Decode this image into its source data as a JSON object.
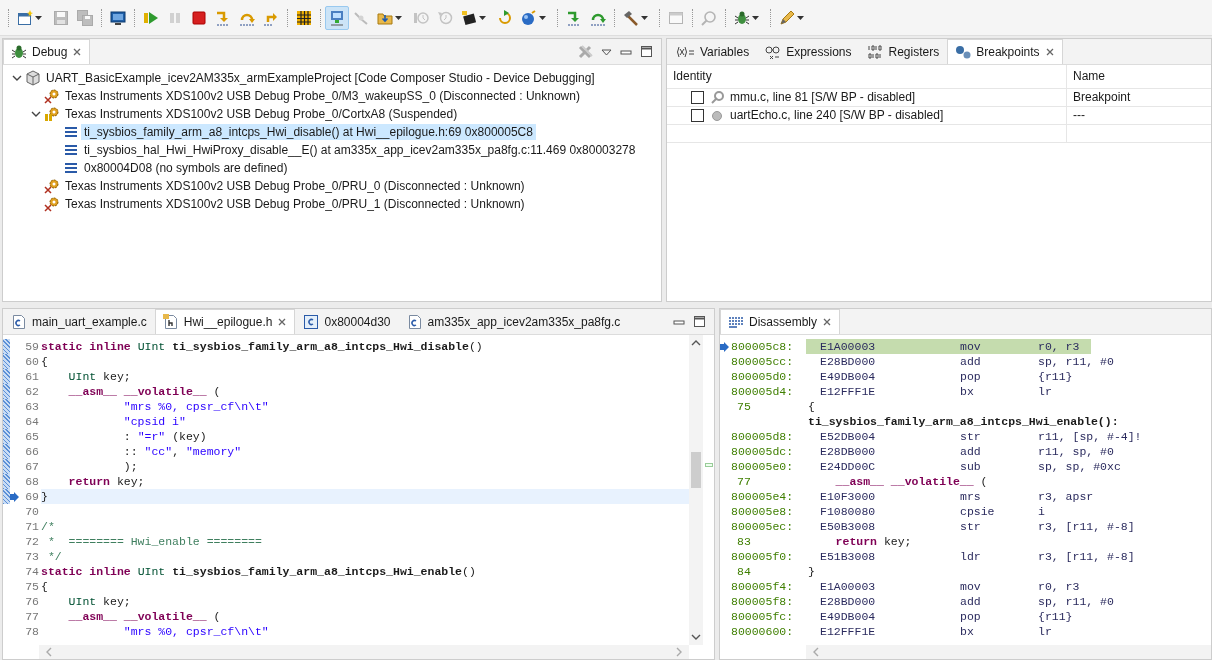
{
  "toolbar": [
    [
      {
        "kind": "new",
        "dropdown": true,
        "disabled": false,
        "selected": false
      },
      {
        "kind": "save",
        "dropdown": false,
        "disabled": true,
        "selected": false
      },
      {
        "kind": "save-all",
        "dropdown": false,
        "disabled": true,
        "selected": false
      }
    ],
    [
      {
        "kind": "monitor",
        "dropdown": false,
        "disabled": false,
        "selected": false
      }
    ],
    [
      {
        "kind": "resume",
        "dropdown": false,
        "disabled": false,
        "selected": false
      },
      {
        "kind": "suspend",
        "dropdown": false,
        "disabled": true,
        "selected": false
      },
      {
        "kind": "terminate",
        "dropdown": false,
        "disabled": false,
        "selected": false
      },
      {
        "kind": "step-into",
        "dropdown": false,
        "disabled": false,
        "selected": false
      },
      {
        "kind": "step-over",
        "dropdown": false,
        "disabled": false,
        "selected": false
      },
      {
        "kind": "step-return",
        "dropdown": false,
        "disabled": false,
        "selected": false
      }
    ],
    [
      {
        "kind": "grid",
        "dropdown": false,
        "disabled": false,
        "selected": false
      }
    ],
    [
      {
        "kind": "connect",
        "dropdown": false,
        "disabled": false,
        "selected": true
      },
      {
        "kind": "cable",
        "dropdown": false,
        "disabled": true,
        "selected": false
      },
      {
        "kind": "load",
        "dropdown": true,
        "disabled": false,
        "selected": false
      },
      {
        "kind": "restart",
        "dropdown": false,
        "disabled": true,
        "selected": false
      },
      {
        "kind": "reset",
        "dropdown": false,
        "disabled": true,
        "selected": false
      },
      {
        "kind": "chip",
        "dropdown": true,
        "disabled": false,
        "selected": false
      },
      {
        "kind": "loop",
        "dropdown": false,
        "disabled": false,
        "selected": false
      },
      {
        "kind": "sphere",
        "dropdown": true,
        "disabled": false,
        "selected": false
      }
    ],
    [
      {
        "kind": "asm-step-into",
        "dropdown": false,
        "disabled": false,
        "selected": false
      },
      {
        "kind": "asm-step-over",
        "dropdown": false,
        "disabled": false,
        "selected": false
      }
    ],
    [
      {
        "kind": "hammer",
        "dropdown": true,
        "disabled": false,
        "selected": false
      }
    ],
    [
      {
        "kind": "window",
        "dropdown": false,
        "disabled": true,
        "selected": false
      }
    ],
    [
      {
        "kind": "search",
        "dropdown": false,
        "disabled": true,
        "selected": false
      }
    ],
    [
      {
        "kind": "bug",
        "dropdown": true,
        "disabled": false,
        "selected": false
      }
    ],
    [
      {
        "kind": "pen",
        "dropdown": true,
        "disabled": false,
        "selected": false
      }
    ]
  ],
  "debug_view": {
    "tab": {
      "label": "Debug",
      "selected": true
    },
    "tree": [
      {
        "kind": "launch",
        "label": "UART_BasicExample_icev2AM335x_armExampleProject [Code Composer Studio - Device Debugging]",
        "expanded": true,
        "selected": false,
        "children": [
          {
            "kind": "target-disconnected",
            "label": "Texas Instruments XDS100v2 USB Debug Probe_0/M3_wakeupSS_0 (Disconnected : Unknown)",
            "selected": false
          },
          {
            "kind": "target-suspended",
            "label": "Texas Instruments XDS100v2 USB Debug Probe_0/CortxA8 (Suspended)",
            "expanded": true,
            "selected": false,
            "children": [
              {
                "kind": "frame",
                "label": "ti_sysbios_family_arm_a8_intcps_Hwi_disable() at Hwi__epilogue.h:69 0x800005C8",
                "selected": true
              },
              {
                "kind": "frame",
                "label": "ti_sysbios_hal_Hwi_HwiProxy_disable__E() at am335x_app_icev2am335x_pa8fg.c:11.469 0x80003278",
                "selected": false
              },
              {
                "kind": "frame",
                "label": "0x80004D08  (no symbols are defined)",
                "selected": false
              }
            ]
          },
          {
            "kind": "target-disconnected",
            "label": "Texas Instruments XDS100v2 USB Debug Probe_0/PRU_0 (Disconnected : Unknown)",
            "selected": false
          },
          {
            "kind": "target-disconnected",
            "label": "Texas Instruments XDS100v2 USB Debug Probe_0/PRU_1 (Disconnected : Unknown)",
            "selected": false
          }
        ]
      }
    ]
  },
  "side_view": {
    "tabs": [
      {
        "kind": "variables",
        "label": "Variables",
        "selected": false
      },
      {
        "kind": "expressions",
        "label": "Expressions",
        "selected": false
      },
      {
        "kind": "registers",
        "label": "Registers",
        "selected": false
      },
      {
        "kind": "breakpoints",
        "label": "Breakpoints",
        "selected": true
      }
    ],
    "columns": [
      "Identity",
      "Name"
    ],
    "breakpoints": [
      {
        "kind": "hook",
        "checked": false,
        "identity": "mmu.c, line 81 [S/W BP - disabled]",
        "name": "Breakpoint"
      },
      {
        "kind": "dot",
        "checked": false,
        "identity": "uartEcho.c, line 240 [S/W BP - disabled]",
        "name": "---"
      }
    ]
  },
  "editor": {
    "tabs": [
      {
        "kind": "c",
        "label": "main_uart_example.c",
        "selected": false
      },
      {
        "kind": "h",
        "label": "Hwi__epilogue.h",
        "selected": true
      },
      {
        "kind": "asm",
        "label": "0x80004d30",
        "selected": false
      },
      {
        "kind": "c",
        "label": "am335x_app_icev2am335x_pa8fg.c",
        "selected": false
      }
    ],
    "lines": [
      {
        "number": "59",
        "in_range": true,
        "current": false,
        "tokens": [
          {
            "kind": "keyword",
            "text": "static"
          },
          {
            "kind": "keyword",
            "text": " inline"
          },
          {
            "kind": "type",
            "text": " UInt"
          },
          {
            "kind": "function",
            "text": " ti_sysbios_family_arm_a8_intcps_Hwi_disable"
          },
          {
            "kind": "plain",
            "text": "()"
          }
        ]
      },
      {
        "number": "60",
        "in_range": true,
        "current": false,
        "tokens": [
          {
            "kind": "plain",
            "text": "{"
          }
        ]
      },
      {
        "number": "61",
        "in_range": true,
        "current": false,
        "tokens": [
          {
            "kind": "type",
            "text": "    UInt"
          },
          {
            "kind": "plain",
            "text": " key;"
          }
        ]
      },
      {
        "number": "62",
        "in_range": true,
        "current": false,
        "tokens": [
          {
            "kind": "keyword",
            "text": "    __asm__"
          },
          {
            "kind": "keyword",
            "text": " __volatile__"
          },
          {
            "kind": "plain",
            "text": " ("
          }
        ]
      },
      {
        "number": "63",
        "in_range": true,
        "current": false,
        "tokens": [
          {
            "kind": "string",
            "text": "            \"mrs %0, cpsr_cf\\n\\t\""
          }
        ]
      },
      {
        "number": "64",
        "in_range": true,
        "current": false,
        "tokens": [
          {
            "kind": "string",
            "text": "            \"cpsid i\""
          }
        ]
      },
      {
        "number": "65",
        "in_range": true,
        "current": false,
        "tokens": [
          {
            "kind": "plain",
            "text": "            : "
          },
          {
            "kind": "string",
            "text": "\"=r\""
          },
          {
            "kind": "plain",
            "text": " (key)"
          }
        ]
      },
      {
        "number": "66",
        "in_range": true,
        "current": false,
        "tokens": [
          {
            "kind": "plain",
            "text": "            :: "
          },
          {
            "kind": "string",
            "text": "\"cc\""
          },
          {
            "kind": "plain",
            "text": ", "
          },
          {
            "kind": "string",
            "text": "\"memory\""
          }
        ]
      },
      {
        "number": "67",
        "in_range": true,
        "current": false,
        "tokens": [
          {
            "kind": "plain",
            "text": "            );"
          }
        ]
      },
      {
        "number": "68",
        "in_range": true,
        "current": false,
        "tokens": [
          {
            "kind": "keyword",
            "text": "    return"
          },
          {
            "kind": "plain",
            "text": " key;"
          }
        ]
      },
      {
        "number": "69",
        "in_range": true,
        "current": true,
        "tokens": [
          {
            "kind": "plain",
            "text": "}"
          }
        ]
      },
      {
        "number": "70",
        "in_range": false,
        "current": false
      },
      {
        "number": "71",
        "in_range": false,
        "current": false,
        "tokens": [
          {
            "kind": "comment",
            "text": "/*"
          }
        ]
      },
      {
        "number": "72",
        "in_range": false,
        "current": false,
        "tokens": [
          {
            "kind": "comment",
            "text": " *  ======== Hwi_enable ========"
          }
        ]
      },
      {
        "number": "73",
        "in_range": false,
        "current": false,
        "tokens": [
          {
            "kind": "comment",
            "text": " */"
          }
        ]
      },
      {
        "number": "74",
        "in_range": false,
        "current": false,
        "tokens": [
          {
            "kind": "keyword",
            "text": "static"
          },
          {
            "kind": "keyword",
            "text": " inline"
          },
          {
            "kind": "type",
            "text": " UInt"
          },
          {
            "kind": "function",
            "text": " ti_sysbios_family_arm_a8_intcps_Hwi_enable"
          },
          {
            "kind": "plain",
            "text": "()"
          }
        ]
      },
      {
        "number": "75",
        "in_range": false,
        "current": false,
        "tokens": [
          {
            "kind": "plain",
            "text": "{"
          }
        ]
      },
      {
        "number": "76",
        "in_range": false,
        "current": false,
        "tokens": [
          {
            "kind": "type",
            "text": "    UInt"
          },
          {
            "kind": "plain",
            "text": " key;"
          }
        ]
      },
      {
        "number": "77",
        "in_range": false,
        "current": false,
        "tokens": [
          {
            "kind": "keyword",
            "text": "    __asm__"
          },
          {
            "kind": "keyword",
            "text": " __volatile__"
          },
          {
            "kind": "plain",
            "text": " ("
          }
        ]
      },
      {
        "number": "78",
        "in_range": false,
        "current": false,
        "tokens": [
          {
            "kind": "string",
            "text": "            \"mrs %0, cpsr_cf\\n\\t\""
          }
        ]
      }
    ]
  },
  "disassembly": {
    "tab": {
      "label": "Disassembly",
      "selected": true
    },
    "rows": [
      {
        "kind": "instruction",
        "address": "800005c8:",
        "opcode": "E1A00003",
        "mnemonic": "mov",
        "operands": "r0, r3",
        "current": true
      },
      {
        "kind": "instruction",
        "address": "800005cc:",
        "opcode": "E28BD000",
        "mnemonic": "add",
        "operands": "sp, r11, #0",
        "current": false
      },
      {
        "kind": "instruction",
        "address": "800005d0:",
        "opcode": "E49DB004",
        "mnemonic": "pop",
        "operands": "{r11}",
        "current": false
      },
      {
        "kind": "instruction",
        "address": "800005d4:",
        "opcode": "E12FFF1E",
        "mnemonic": "bx",
        "operands": "lr",
        "current": false
      },
      {
        "kind": "source",
        "line": "75",
        "tokens": [
          {
            "kind": "plain",
            "text": "{"
          }
        ]
      },
      {
        "kind": "label",
        "text": "ti_sysbios_family_arm_a8_intcps_Hwi_enable():"
      },
      {
        "kind": "instruction",
        "address": "800005d8:",
        "opcode": "E52DB004",
        "mnemonic": "str",
        "operands": "r11, [sp, #-4]!",
        "current": false
      },
      {
        "kind": "instruction",
        "address": "800005dc:",
        "opcode": "E28DB000",
        "mnemonic": "add",
        "operands": "r11, sp, #0",
        "current": false
      },
      {
        "kind": "instruction",
        "address": "800005e0:",
        "opcode": "E24DD00C",
        "mnemonic": "sub",
        "operands": "sp, sp, #0xc",
        "current": false
      },
      {
        "kind": "source",
        "line": "77",
        "tokens": [
          {
            "kind": "keyword",
            "text": "    __asm__"
          },
          {
            "kind": "keyword",
            "text": " __volatile__"
          },
          {
            "kind": "plain",
            "text": " ("
          }
        ]
      },
      {
        "kind": "instruction",
        "address": "800005e4:",
        "opcode": "E10F3000",
        "mnemonic": "mrs",
        "operands": "r3, apsr",
        "current": false
      },
      {
        "kind": "instruction",
        "address": "800005e8:",
        "opcode": "F1080080",
        "mnemonic": "cpsie",
        "operands": "i",
        "current": false
      },
      {
        "kind": "instruction",
        "address": "800005ec:",
        "opcode": "E50B3008",
        "mnemonic": "str",
        "operands": "r3, [r11, #-8]",
        "current": false
      },
      {
        "kind": "source",
        "line": "83",
        "tokens": [
          {
            "kind": "keyword",
            "text": "    return"
          },
          {
            "kind": "plain",
            "text": " key;"
          }
        ]
      },
      {
        "kind": "instruction",
        "address": "800005f0:",
        "opcode": "E51B3008",
        "mnemonic": "ldr",
        "operands": "r3, [r11, #-8]",
        "current": false
      },
      {
        "kind": "source",
        "line": "84",
        "tokens": [
          {
            "kind": "plain",
            "text": "}"
          }
        ]
      },
      {
        "kind": "instruction",
        "address": "800005f4:",
        "opcode": "E1A00003",
        "mnemonic": "mov",
        "operands": "r0, r3",
        "current": false
      },
      {
        "kind": "instruction",
        "address": "800005f8:",
        "opcode": "E28BD000",
        "mnemonic": "add",
        "operands": "sp, r11, #0",
        "current": false
      },
      {
        "kind": "instruction",
        "address": "800005fc:",
        "opcode": "E49DB004",
        "mnemonic": "pop",
        "operands": "{r11}",
        "current": false
      },
      {
        "kind": "instruction",
        "address": "80000600:",
        "opcode": "E12FFF1E",
        "mnemonic": "bx",
        "operands": "lr",
        "current": false
      }
    ]
  }
}
